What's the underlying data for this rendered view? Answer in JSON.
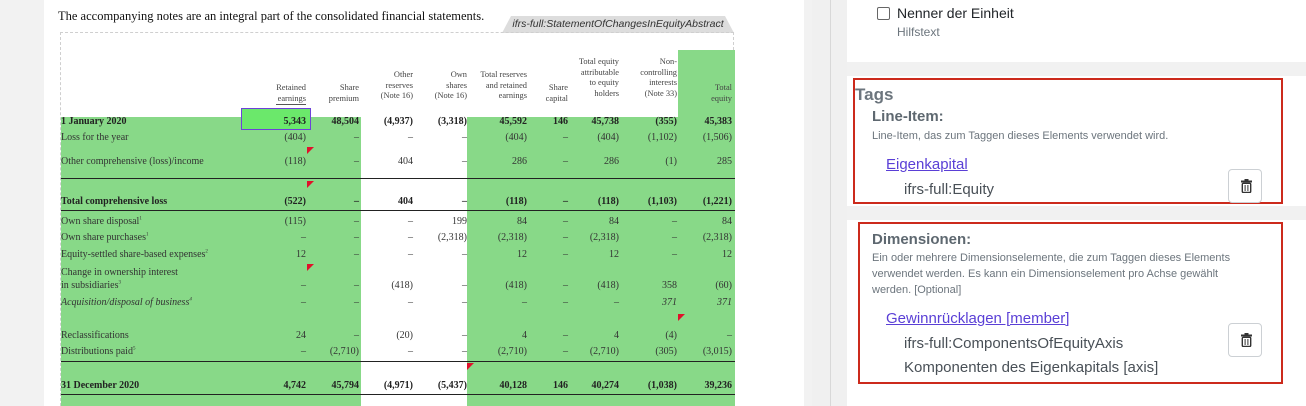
{
  "document": {
    "intro": "The accompanying notes are an integral part of the consolidated financial statements.",
    "concept_tag": "ifrs-full:StatementOfChangesInEquityAbstract",
    "columns": [
      {
        "lines": [
          "Retained",
          "earnings"
        ]
      },
      {
        "lines": [
          "Share",
          "premium"
        ]
      },
      {
        "lines": [
          "Other",
          "reserves",
          "(Note 16)"
        ]
      },
      {
        "lines": [
          "Own",
          "shares",
          "(Note 16)"
        ]
      },
      {
        "lines": [
          "Total reserves",
          "and retained",
          "earnings"
        ]
      },
      {
        "lines": [
          "Share",
          "capital"
        ]
      },
      {
        "lines": [
          "Total equity",
          "attributable",
          "to equity",
          "holders"
        ]
      },
      {
        "lines": [
          "Non-",
          "controlling",
          "interests",
          "(Note 33)"
        ]
      },
      {
        "lines": [
          "Total",
          "equity"
        ]
      }
    ],
    "rows": [
      {
        "label": "1 January 2020",
        "fn": "",
        "bold": true,
        "italic": false,
        "values": [
          "5,343",
          "48,504",
          "(4,937)",
          "(3,318)",
          "45,592",
          "146",
          "45,738",
          "(355)",
          "45,383"
        ]
      },
      {
        "label": "Loss for the year",
        "fn": "",
        "bold": false,
        "italic": false,
        "values": [
          "(404)",
          "–",
          "–",
          "–",
          "(404)",
          "–",
          "(404)",
          "(1,102)",
          "(1,506)"
        ]
      },
      {
        "label": "Other comprehensive (loss)/income",
        "fn": "",
        "bold": false,
        "italic": false,
        "values": [
          "(118)",
          "–",
          "404",
          "–",
          "286",
          "–",
          "286",
          "(1)",
          "285"
        ]
      },
      {
        "label": "Total comprehensive loss",
        "fn": "",
        "bold": true,
        "italic": false,
        "values": [
          "(522)",
          "–",
          "404",
          "–",
          "(118)",
          "–",
          "(118)",
          "(1,103)",
          "(1,221)"
        ]
      },
      {
        "label": "Own share disposal",
        "fn": "1",
        "bold": false,
        "italic": false,
        "values": [
          "(115)",
          "–",
          "–",
          "199",
          "84",
          "–",
          "84",
          "–",
          "84"
        ]
      },
      {
        "label": "Own share purchases",
        "fn": "1",
        "bold": false,
        "italic": false,
        "values": [
          "–",
          "–",
          "–",
          "(2,318)",
          "(2,318)",
          "–",
          "(2,318)",
          "–",
          "(2,318)"
        ]
      },
      {
        "label": "Equity-settled share-based expenses",
        "fn": "2",
        "bold": false,
        "italic": false,
        "values": [
          "12",
          "–",
          "–",
          "–",
          "12",
          "–",
          "12",
          "–",
          "12"
        ]
      },
      {
        "label": "Change in ownership interest",
        "fn": "",
        "bold": false,
        "italic": false,
        "values": [
          "",
          "",
          "",
          "",
          "",
          "",
          "",
          "",
          ""
        ]
      },
      {
        "label": "in subsidiaries",
        "fn": "3",
        "bold": false,
        "italic": false,
        "values": [
          "–",
          "–",
          "(418)",
          "–",
          "(418)",
          "–",
          "(418)",
          "358",
          "(60)"
        ]
      },
      {
        "label": "Acquisition/disposal of business",
        "fn": "4",
        "bold": false,
        "italic": true,
        "values": [
          "–",
          "–",
          "–",
          "–",
          "–",
          "–",
          "–",
          "371",
          "371"
        ]
      },
      {
        "label": "Reclassifications",
        "fn": "",
        "bold": false,
        "italic": false,
        "values": [
          "24",
          "–",
          "(20)",
          "–",
          "4",
          "–",
          "4",
          "(4)",
          "–"
        ]
      },
      {
        "label": "Distributions paid",
        "fn": "5",
        "bold": false,
        "italic": false,
        "values": [
          "–",
          "(2,710)",
          "–",
          "–",
          "(2,710)",
          "–",
          "(2,710)",
          "(305)",
          "(3,015)"
        ]
      },
      {
        "label": "31 December 2020",
        "fn": "",
        "bold": true,
        "italic": false,
        "values": [
          "4,742",
          "45,794",
          "(4,971)",
          "(5,437)",
          "40,128",
          "146",
          "40,274",
          "(1,038)",
          "39,236"
        ]
      }
    ]
  },
  "sidebar": {
    "unit_denominator": {
      "label": "Nenner der Einheit",
      "help": "Hilfstext",
      "checked": false
    },
    "tags_title": "Tags",
    "line_item": {
      "title": "Line-Item:",
      "description": "Line-Item, das zum Taggen dieses Elements verwendet wird.",
      "link": "Eigenkapital",
      "qname": "ifrs-full:Equity"
    },
    "dimensions": {
      "title": "Dimensionen:",
      "description": [
        "Ein oder mehrere Dimensionselemente, die zum Taggen dieses Elements",
        "verwendet werden. Es kann ein Dimensionselement pro Achse gewählt",
        "werden. [Optional]"
      ],
      "link": "Gewinnrücklagen [member]",
      "axis_qname": "ifrs-full:ComponentsOfEquityAxis",
      "axis_label": "Komponenten des Eigenkapitals [axis]"
    }
  },
  "colors": {
    "highlight": "#88d988",
    "selected": "#6be86b",
    "frame": "#cc2a1c",
    "link": "#5a3fd6",
    "flag": "#e0112b"
  },
  "icons": [
    "trash-icon",
    "checkbox-icon"
  ]
}
